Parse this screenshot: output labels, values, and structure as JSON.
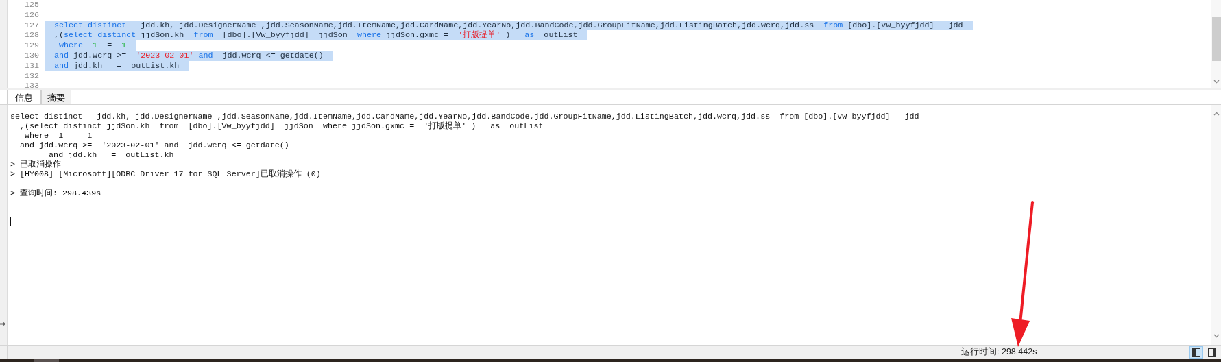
{
  "editor": {
    "lines": [
      {
        "number": "125"
      },
      {
        "number": "126"
      },
      {
        "number": "127",
        "selected": true,
        "tokens": [
          {
            "kind": "keyword",
            "text": "select distinct"
          },
          {
            "kind": "plain",
            "text": "   jdd.kh, jdd.DesignerName ,jdd.SeasonName,jdd.ItemName,jdd.CardName,jdd.YearNo,jdd.BandCode,jdd.GroupFitName,jdd.ListingBatch,jdd.wcrq,jdd.ss  "
          },
          {
            "kind": "keyword",
            "text": "from"
          },
          {
            "kind": "plain",
            "text": " [dbo].[Vw_byyfjdd]   jdd"
          }
        ]
      },
      {
        "number": "128",
        "selected": true,
        "tokens": [
          {
            "kind": "plain",
            "text": ",("
          },
          {
            "kind": "keyword",
            "text": "select distinct"
          },
          {
            "kind": "plain",
            "text": " jjdSon.kh  "
          },
          {
            "kind": "keyword",
            "text": "from"
          },
          {
            "kind": "plain",
            "text": "  [dbo].[Vw_byyfjdd]  jjdSon  "
          },
          {
            "kind": "keyword",
            "text": "where"
          },
          {
            "kind": "plain",
            "text": " jjdSon.gxmc =  "
          },
          {
            "kind": "string",
            "text": "'打版提单'"
          },
          {
            "kind": "plain",
            "text": " )   "
          },
          {
            "kind": "keyword",
            "text": "as"
          },
          {
            "kind": "plain",
            "text": "  outList"
          }
        ]
      },
      {
        "number": "129",
        "selected": true,
        "tokens": [
          {
            "kind": "keyword",
            "text": " where"
          },
          {
            "kind": "number",
            "text": "  1"
          },
          {
            "kind": "plain",
            "text": "  =  "
          },
          {
            "kind": "number",
            "text": "1"
          }
        ]
      },
      {
        "number": "130",
        "selected": true,
        "tokens": [
          {
            "kind": "keyword",
            "text": "and"
          },
          {
            "kind": "plain",
            "text": " jdd.wcrq >=  "
          },
          {
            "kind": "string",
            "text": "'2023-02-01'"
          },
          {
            "kind": "keyword",
            "text": " and"
          },
          {
            "kind": "plain",
            "text": "  jdd.wcrq <= getdate()"
          }
        ]
      },
      {
        "number": "131",
        "selected": true,
        "tokens": [
          {
            "kind": "keyword",
            "text": "and"
          },
          {
            "kind": "plain",
            "text": " jdd.kh   =  outList.kh"
          }
        ]
      },
      {
        "number": "132"
      },
      {
        "number": "133"
      }
    ]
  },
  "tabs": [
    {
      "label": "信息",
      "selected": true
    },
    {
      "label": "摘要",
      "selected": false
    }
  ],
  "output": {
    "blocks": [
      [
        "select distinct   jdd.kh, jdd.DesignerName ,jdd.SeasonName,jdd.ItemName,jdd.CardName,jdd.YearNo,jdd.BandCode,jdd.GroupFitName,jdd.ListingBatch,jdd.wcrq,jdd.ss  from [dbo].[Vw_byyfjdd]   jdd",
        "  ,(select distinct jjdSon.kh  from  [dbo].[Vw_byyfjdd]  jjdSon  where jjdSon.gxmc =  '打版提单' )   as  outList",
        "   where  1  =  1",
        "  and jdd.wcrq >=  '2023-02-01' and  jdd.wcrq <= getdate()",
        "        and jdd.kh   =  outList.kh",
        "> 已取消操作",
        "> [HY008] [Microsoft][ODBC Driver 17 for SQL Server]已取消操作 (0)"
      ],
      [
        "> 查询时间: 298.439s"
      ]
    ]
  },
  "status_bar": {
    "run_time": "运行时间: 298.442s",
    "layout_buttons": [
      {
        "selected": true
      },
      {
        "selected": false
      }
    ]
  }
}
